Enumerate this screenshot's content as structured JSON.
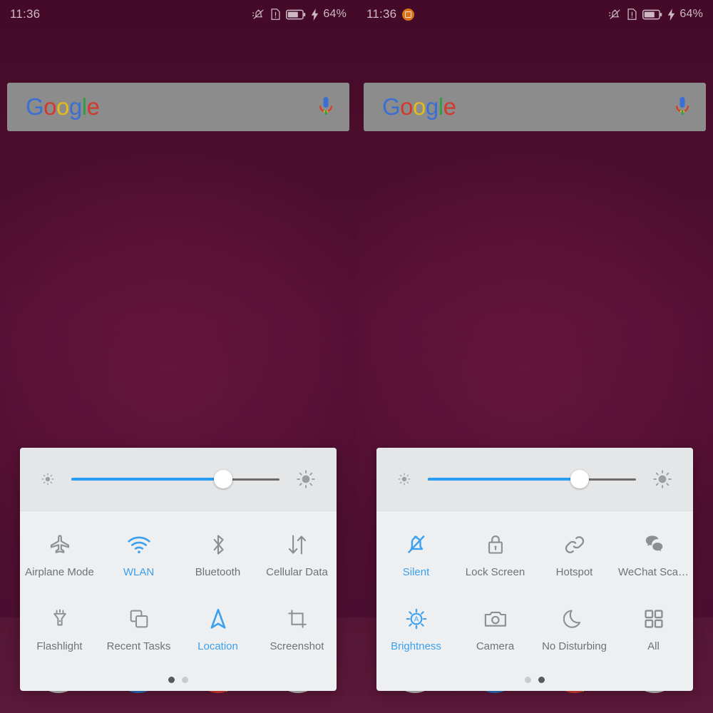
{
  "meta": {
    "view": "android-home-screen-with-control-center",
    "panels": 2
  },
  "colors": {
    "wallpaper_top": "#430a28",
    "wallpaper_mid": "#530f33",
    "wallpaper_bottom": "#5a1838",
    "panel_bg": "#eeeff0",
    "slider_bg": "#e4e6e8",
    "accent_blue": "#3ba0ef",
    "slider_fill": "#2a9df4",
    "icon_gray": "#8b8e92",
    "label_gray": "#6f7276",
    "status_text": "#cdb8c3",
    "notification_badge": "#d9741a",
    "search_bar": "#8c8c8c"
  },
  "left": {
    "statusbar": {
      "time": "11:36",
      "battery_percent": "64%",
      "icons": [
        "silent-bell-icon",
        "sim-alert-icon",
        "battery-icon",
        "charging-bolt-icon"
      ],
      "notification_badge": null
    },
    "search_widget": {
      "logo_letters": [
        {
          "ch": "G",
          "color": "#3b6fd4"
        },
        {
          "ch": "o",
          "color": "#d03b2e"
        },
        {
          "ch": "o",
          "color": "#e3bc1b"
        },
        {
          "ch": "g",
          "color": "#3b6fd4"
        },
        {
          "ch": "l",
          "color": "#2f9e45"
        },
        {
          "ch": "e",
          "color": "#d03b2e"
        }
      ],
      "logo_text": "Google",
      "mic_icon": "microphone-icon"
    },
    "control_center": {
      "brightness": {
        "low_icon": "brightness-low-icon",
        "high_icon": "brightness-high-icon",
        "value_percent": 73
      },
      "toggles": [
        {
          "label": "Airplane Mode",
          "icon": "airplane-icon",
          "active": false
        },
        {
          "label": "WLAN",
          "icon": "wifi-icon",
          "active": true
        },
        {
          "label": "Bluetooth",
          "icon": "bluetooth-icon",
          "active": false
        },
        {
          "label": "Cellular Data",
          "icon": "data-transfer-icon",
          "active": false
        },
        {
          "label": "Flashlight",
          "icon": "flashlight-icon",
          "active": false
        },
        {
          "label": "Recent Tasks",
          "icon": "recent-tasks-icon",
          "active": false
        },
        {
          "label": "Location",
          "icon": "location-arrow-icon",
          "active": true
        },
        {
          "label": "Screenshot",
          "icon": "screenshot-crop-icon",
          "active": false
        }
      ],
      "pager": {
        "pages": 2,
        "current": 1
      }
    },
    "dock": [
      {
        "name": "dock-app-1",
        "color": "#b6b6b6"
      },
      {
        "name": "dock-app-2",
        "color": "#2a6cb5"
      },
      {
        "name": "dock-app-3",
        "color": "#1e9c4a"
      },
      {
        "name": "dock-app-4",
        "color": "#b6b6b6"
      }
    ]
  },
  "right": {
    "statusbar": {
      "time": "11:36",
      "battery_percent": "64%",
      "icons": [
        "silent-bell-icon",
        "sim-alert-icon",
        "battery-icon",
        "charging-bolt-icon"
      ],
      "notification_badge": "screenshot-notification-badge"
    },
    "search_widget": {
      "logo_letters": [
        {
          "ch": "G",
          "color": "#3b6fd4"
        },
        {
          "ch": "o",
          "color": "#d03b2e"
        },
        {
          "ch": "o",
          "color": "#e3bc1b"
        },
        {
          "ch": "g",
          "color": "#3b6fd4"
        },
        {
          "ch": "l",
          "color": "#2f9e45"
        },
        {
          "ch": "e",
          "color": "#d03b2e"
        }
      ],
      "logo_text": "Google",
      "mic_icon": "microphone-icon"
    },
    "control_center": {
      "brightness": {
        "low_icon": "brightness-low-icon",
        "high_icon": "brightness-high-icon",
        "value_percent": 73
      },
      "toggles": [
        {
          "label": "Silent",
          "icon": "silent-bell-icon",
          "active": true
        },
        {
          "label": "Lock Screen",
          "icon": "lock-icon",
          "active": false
        },
        {
          "label": "Hotspot",
          "icon": "link-icon",
          "active": false
        },
        {
          "label": "WeChat Sca…",
          "icon": "wechat-scan-icon",
          "active": false
        },
        {
          "label": "Brightness",
          "icon": "auto-brightness-icon",
          "active": true
        },
        {
          "label": "Camera",
          "icon": "camera-icon",
          "active": false
        },
        {
          "label": "No Disturbing",
          "icon": "moon-icon",
          "active": false
        },
        {
          "label": "All",
          "icon": "grid-all-icon",
          "active": false
        }
      ],
      "pager": {
        "pages": 2,
        "current": 2
      }
    },
    "dock": [
      {
        "name": "dock-app-1",
        "color": "#b6b6b6"
      },
      {
        "name": "dock-app-2",
        "color": "#2a6cb5"
      },
      {
        "name": "dock-app-3",
        "color": "#1e9c4a"
      },
      {
        "name": "dock-app-4",
        "color": "#b6b6b6"
      }
    ]
  }
}
